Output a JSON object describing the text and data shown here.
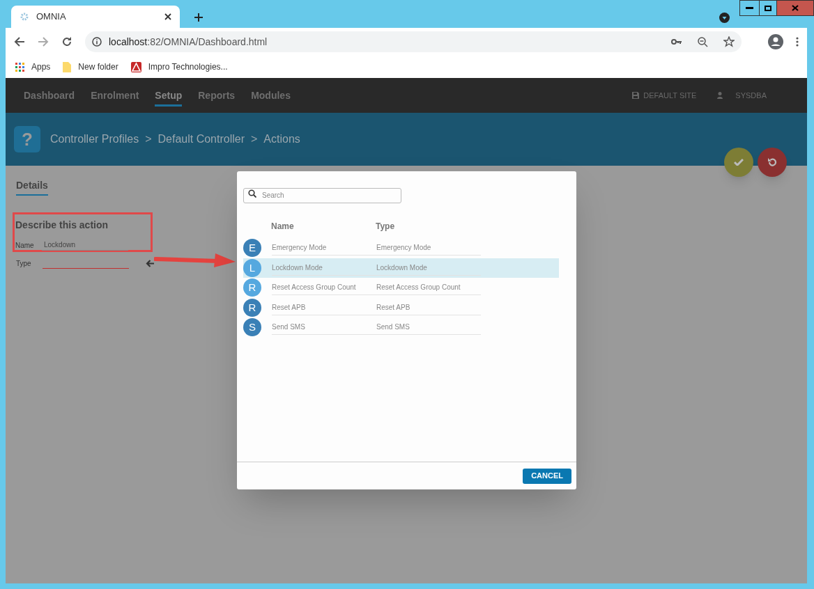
{
  "browser": {
    "tab_title": "OMNIA",
    "url_host": "localhost",
    "url_rest": ":82/OMNIA/Dashboard.html",
    "bookmarks": [
      {
        "label": "Apps",
        "kind": "apps"
      },
      {
        "label": "New folder",
        "kind": "folder"
      },
      {
        "label": "Impro Technologies...",
        "kind": "site"
      }
    ]
  },
  "nav": {
    "items": [
      {
        "label": "Dashboard",
        "selected": false
      },
      {
        "label": "Enrolment",
        "selected": false
      },
      {
        "label": "Setup",
        "selected": true
      },
      {
        "label": "Reports",
        "selected": false
      },
      {
        "label": "Modules",
        "selected": false
      }
    ],
    "site": "DEFAULT SITE",
    "user": "SYSDBA"
  },
  "header": {
    "icon_glyph": "?",
    "breadcrumb": [
      "Controller Profiles",
      ">",
      "Default Controller",
      ">",
      "Actions"
    ]
  },
  "tabs": [
    {
      "label": "Details",
      "selected": true
    }
  ],
  "form": {
    "heading": "Describe this action",
    "fields": [
      {
        "label": "Name",
        "value": "Lockdown",
        "invalid": false
      },
      {
        "label": "Type",
        "invalid": true
      }
    ]
  },
  "dialog": {
    "search": {
      "placeholder": "Search"
    },
    "columns": [
      "Name",
      "Type"
    ],
    "rows": [
      {
        "initial": "E",
        "name": "Emergency Mode",
        "type": "Emergency Mode",
        "color": "#3a80b6",
        "selected": false
      },
      {
        "initial": "L",
        "name": "Lockdown Mode",
        "type": "Lockdown Mode",
        "color": "#55a8df",
        "selected": true
      },
      {
        "initial": "R",
        "name": "Reset Access Group Count",
        "type": "Reset Access Group Count",
        "color": "#55a8df",
        "selected": false
      },
      {
        "initial": "R",
        "name": "Reset APB",
        "type": "Reset APB",
        "color": "#3a80b6",
        "selected": false
      },
      {
        "initial": "S",
        "name": "Send SMS",
        "type": "Send SMS",
        "color": "#3a80b6",
        "selected": false
      }
    ],
    "cancel": "CANCEL"
  }
}
